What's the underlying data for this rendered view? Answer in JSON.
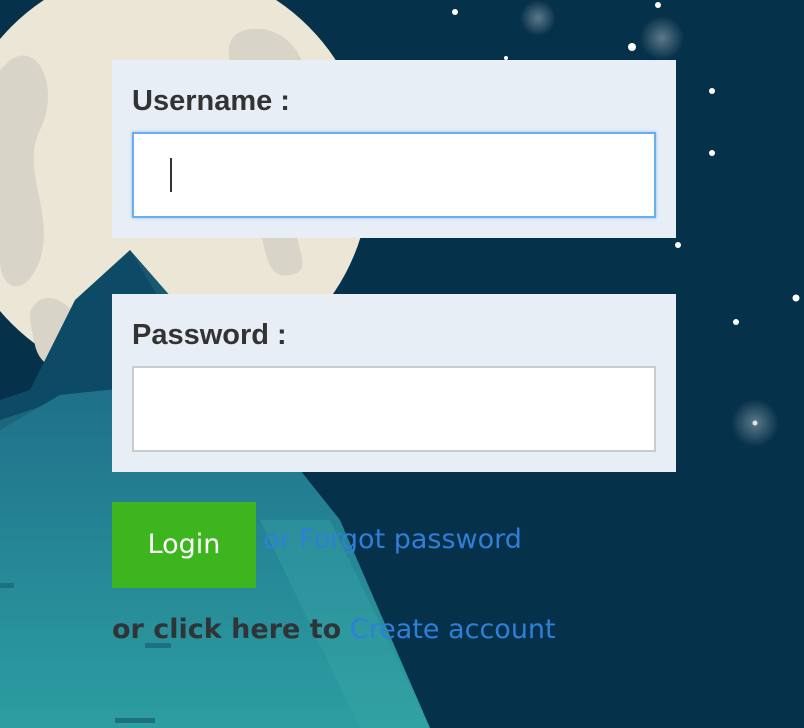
{
  "username": {
    "label": "Username :",
    "value": "",
    "placeholder": ""
  },
  "password": {
    "label": "Password :",
    "value": "",
    "placeholder": ""
  },
  "actions": {
    "login_label": "Login",
    "forgot_link": "or Forgot password",
    "create_prefix": "or click here to",
    "create_link": "Create account"
  },
  "colors": {
    "background_sky": "#06314a",
    "panel": "#e8eef6",
    "login_button": "#3db51e",
    "link": "#2f7fd8",
    "label_text": "#333333"
  },
  "icons": {
    "background": "night-sky-moon-mountain-illustration"
  }
}
